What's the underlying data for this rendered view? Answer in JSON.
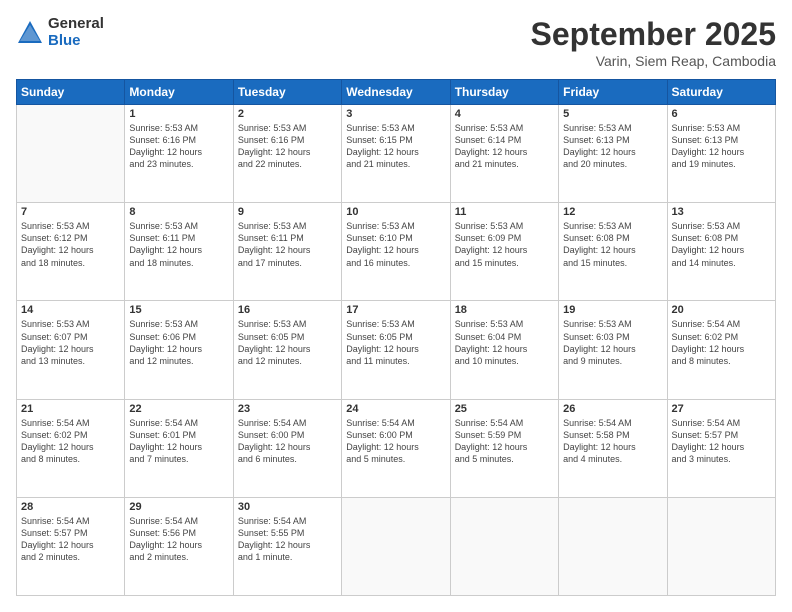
{
  "logo": {
    "general": "General",
    "blue": "Blue"
  },
  "title": "September 2025",
  "subtitle": "Varin, Siem Reap, Cambodia",
  "days_header": [
    "Sunday",
    "Monday",
    "Tuesday",
    "Wednesday",
    "Thursday",
    "Friday",
    "Saturday"
  ],
  "weeks": [
    [
      {
        "day": "",
        "info": ""
      },
      {
        "day": "1",
        "info": "Sunrise: 5:53 AM\nSunset: 6:16 PM\nDaylight: 12 hours\nand 23 minutes."
      },
      {
        "day": "2",
        "info": "Sunrise: 5:53 AM\nSunset: 6:16 PM\nDaylight: 12 hours\nand 22 minutes."
      },
      {
        "day": "3",
        "info": "Sunrise: 5:53 AM\nSunset: 6:15 PM\nDaylight: 12 hours\nand 21 minutes."
      },
      {
        "day": "4",
        "info": "Sunrise: 5:53 AM\nSunset: 6:14 PM\nDaylight: 12 hours\nand 21 minutes."
      },
      {
        "day": "5",
        "info": "Sunrise: 5:53 AM\nSunset: 6:13 PM\nDaylight: 12 hours\nand 20 minutes."
      },
      {
        "day": "6",
        "info": "Sunrise: 5:53 AM\nSunset: 6:13 PM\nDaylight: 12 hours\nand 19 minutes."
      }
    ],
    [
      {
        "day": "7",
        "info": "Sunrise: 5:53 AM\nSunset: 6:12 PM\nDaylight: 12 hours\nand 18 minutes."
      },
      {
        "day": "8",
        "info": "Sunrise: 5:53 AM\nSunset: 6:11 PM\nDaylight: 12 hours\nand 18 minutes."
      },
      {
        "day": "9",
        "info": "Sunrise: 5:53 AM\nSunset: 6:11 PM\nDaylight: 12 hours\nand 17 minutes."
      },
      {
        "day": "10",
        "info": "Sunrise: 5:53 AM\nSunset: 6:10 PM\nDaylight: 12 hours\nand 16 minutes."
      },
      {
        "day": "11",
        "info": "Sunrise: 5:53 AM\nSunset: 6:09 PM\nDaylight: 12 hours\nand 15 minutes."
      },
      {
        "day": "12",
        "info": "Sunrise: 5:53 AM\nSunset: 6:08 PM\nDaylight: 12 hours\nand 15 minutes."
      },
      {
        "day": "13",
        "info": "Sunrise: 5:53 AM\nSunset: 6:08 PM\nDaylight: 12 hours\nand 14 minutes."
      }
    ],
    [
      {
        "day": "14",
        "info": "Sunrise: 5:53 AM\nSunset: 6:07 PM\nDaylight: 12 hours\nand 13 minutes."
      },
      {
        "day": "15",
        "info": "Sunrise: 5:53 AM\nSunset: 6:06 PM\nDaylight: 12 hours\nand 12 minutes."
      },
      {
        "day": "16",
        "info": "Sunrise: 5:53 AM\nSunset: 6:05 PM\nDaylight: 12 hours\nand 12 minutes."
      },
      {
        "day": "17",
        "info": "Sunrise: 5:53 AM\nSunset: 6:05 PM\nDaylight: 12 hours\nand 11 minutes."
      },
      {
        "day": "18",
        "info": "Sunrise: 5:53 AM\nSunset: 6:04 PM\nDaylight: 12 hours\nand 10 minutes."
      },
      {
        "day": "19",
        "info": "Sunrise: 5:53 AM\nSunset: 6:03 PM\nDaylight: 12 hours\nand 9 minutes."
      },
      {
        "day": "20",
        "info": "Sunrise: 5:54 AM\nSunset: 6:02 PM\nDaylight: 12 hours\nand 8 minutes."
      }
    ],
    [
      {
        "day": "21",
        "info": "Sunrise: 5:54 AM\nSunset: 6:02 PM\nDaylight: 12 hours\nand 8 minutes."
      },
      {
        "day": "22",
        "info": "Sunrise: 5:54 AM\nSunset: 6:01 PM\nDaylight: 12 hours\nand 7 minutes."
      },
      {
        "day": "23",
        "info": "Sunrise: 5:54 AM\nSunset: 6:00 PM\nDaylight: 12 hours\nand 6 minutes."
      },
      {
        "day": "24",
        "info": "Sunrise: 5:54 AM\nSunset: 6:00 PM\nDaylight: 12 hours\nand 5 minutes."
      },
      {
        "day": "25",
        "info": "Sunrise: 5:54 AM\nSunset: 5:59 PM\nDaylight: 12 hours\nand 5 minutes."
      },
      {
        "day": "26",
        "info": "Sunrise: 5:54 AM\nSunset: 5:58 PM\nDaylight: 12 hours\nand 4 minutes."
      },
      {
        "day": "27",
        "info": "Sunrise: 5:54 AM\nSunset: 5:57 PM\nDaylight: 12 hours\nand 3 minutes."
      }
    ],
    [
      {
        "day": "28",
        "info": "Sunrise: 5:54 AM\nSunset: 5:57 PM\nDaylight: 12 hours\nand 2 minutes."
      },
      {
        "day": "29",
        "info": "Sunrise: 5:54 AM\nSunset: 5:56 PM\nDaylight: 12 hours\nand 2 minutes."
      },
      {
        "day": "30",
        "info": "Sunrise: 5:54 AM\nSunset: 5:55 PM\nDaylight: 12 hours\nand 1 minute."
      },
      {
        "day": "",
        "info": ""
      },
      {
        "day": "",
        "info": ""
      },
      {
        "day": "",
        "info": ""
      },
      {
        "day": "",
        "info": ""
      }
    ]
  ]
}
